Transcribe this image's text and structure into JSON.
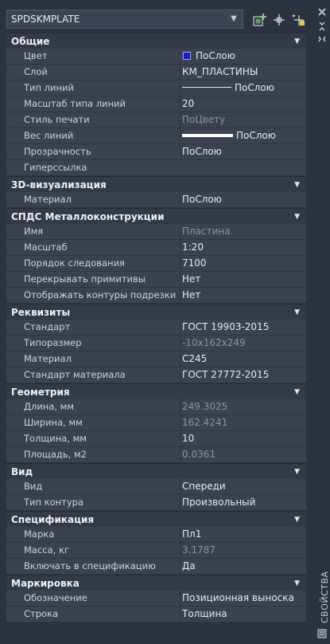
{
  "dropdown": {
    "value": "SPDSKMPLATE"
  },
  "sidebar_label": "СВОЙСТВА",
  "sections": [
    {
      "title": "Общие",
      "rows": [
        {
          "k": "Цвет",
          "v": "ПоСлою",
          "style": "swatch"
        },
        {
          "k": "Слой",
          "v": "КМ_ПЛАСТИНЫ"
        },
        {
          "k": "Тип линий",
          "v": "ПоСлою",
          "style": "thin"
        },
        {
          "k": "Масштаб типа линий",
          "v": "20"
        },
        {
          "k": "Стиль печати",
          "v": "ПоЦвету",
          "style": "ro"
        },
        {
          "k": "Вес линий",
          "v": "ПоСлою",
          "style": "thick"
        },
        {
          "k": "Прозрачность",
          "v": "ПоСлою"
        },
        {
          "k": "Гиперссылка",
          "v": ""
        }
      ]
    },
    {
      "title": "3D-визуализация",
      "rows": [
        {
          "k": "Материал",
          "v": "ПоСлою"
        }
      ]
    },
    {
      "title": "СПДС Металлоконструкции",
      "rows": [
        {
          "k": "Имя",
          "v": "Пластина",
          "style": "ro"
        },
        {
          "k": "Масштаб",
          "v": "1:20"
        },
        {
          "k": "Порядок следования",
          "v": "7100"
        },
        {
          "k": "Перекрывать примитивы",
          "v": "Нет"
        },
        {
          "k": "Отображать контуры подрезки",
          "v": "Нет"
        }
      ]
    },
    {
      "title": "Реквизиты",
      "rows": [
        {
          "k": "Стандарт",
          "v": "ГОСТ 19903-2015"
        },
        {
          "k": "Типоразмер",
          "v": "-10x162x249",
          "style": "ro"
        },
        {
          "k": "Материал",
          "v": "С245"
        },
        {
          "k": "Стандарт материала",
          "v": "ГОСТ 27772-2015"
        }
      ]
    },
    {
      "title": "Геометрия",
      "rows": [
        {
          "k": "Длина, мм",
          "v": "249.3025",
          "style": "ro"
        },
        {
          "k": "Ширина, мм",
          "v": "162.4241",
          "style": "ro"
        },
        {
          "k": "Толщина, мм",
          "v": "10"
        },
        {
          "k": "Площадь, м2",
          "v": "0.0361",
          "style": "ro"
        }
      ]
    },
    {
      "title": "Вид",
      "rows": [
        {
          "k": "Вид",
          "v": "Спереди"
        },
        {
          "k": "Тип контура",
          "v": "Произвольный"
        }
      ]
    },
    {
      "title": "Спецификация",
      "rows": [
        {
          "k": "Марка",
          "v": "Пл1"
        },
        {
          "k": "Масса, кг",
          "v": "3.1787",
          "style": "ro"
        },
        {
          "k": "Включать в спецификацию",
          "v": "Да"
        }
      ]
    },
    {
      "title": "Маркировка",
      "rows": [
        {
          "k": "Обозначение",
          "v": "Позиционная выноска"
        },
        {
          "k": "Строка",
          "v": "Толщина"
        }
      ]
    }
  ]
}
